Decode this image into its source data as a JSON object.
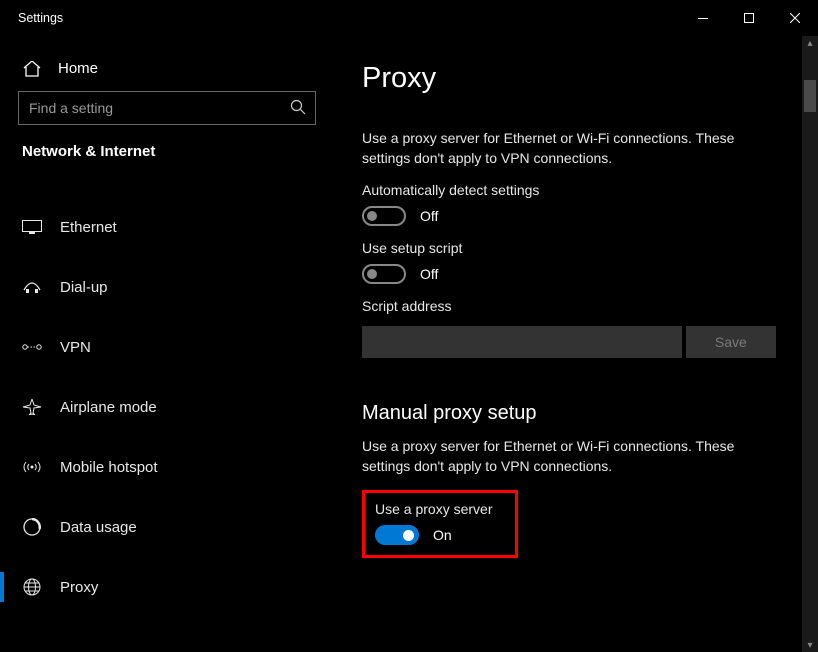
{
  "titlebar": {
    "title": "Settings"
  },
  "sidebar": {
    "home_label": "Home",
    "search_placeholder": "Find a setting",
    "section_label": "Network & Internet",
    "items": [
      {
        "label": "Ethernet"
      },
      {
        "label": "Dial-up"
      },
      {
        "label": "VPN"
      },
      {
        "label": "Airplane mode"
      },
      {
        "label": "Mobile hotspot"
      },
      {
        "label": "Data usage"
      },
      {
        "label": "Proxy"
      }
    ]
  },
  "main": {
    "page_title": "Proxy",
    "desc1": "Use a proxy server for Ethernet or Wi-Fi connections. These settings don't apply to VPN connections.",
    "auto_detect": {
      "label": "Automatically detect settings",
      "state": "Off"
    },
    "setup_script": {
      "label": "Use setup script",
      "state": "Off"
    },
    "script_address": {
      "label": "Script address",
      "value": ""
    },
    "save_label": "Save",
    "manual_title": "Manual proxy setup",
    "desc2": "Use a proxy server for Ethernet or Wi-Fi connections. These settings don't apply to VPN connections.",
    "use_proxy": {
      "label": "Use a proxy server",
      "state": "On"
    }
  }
}
